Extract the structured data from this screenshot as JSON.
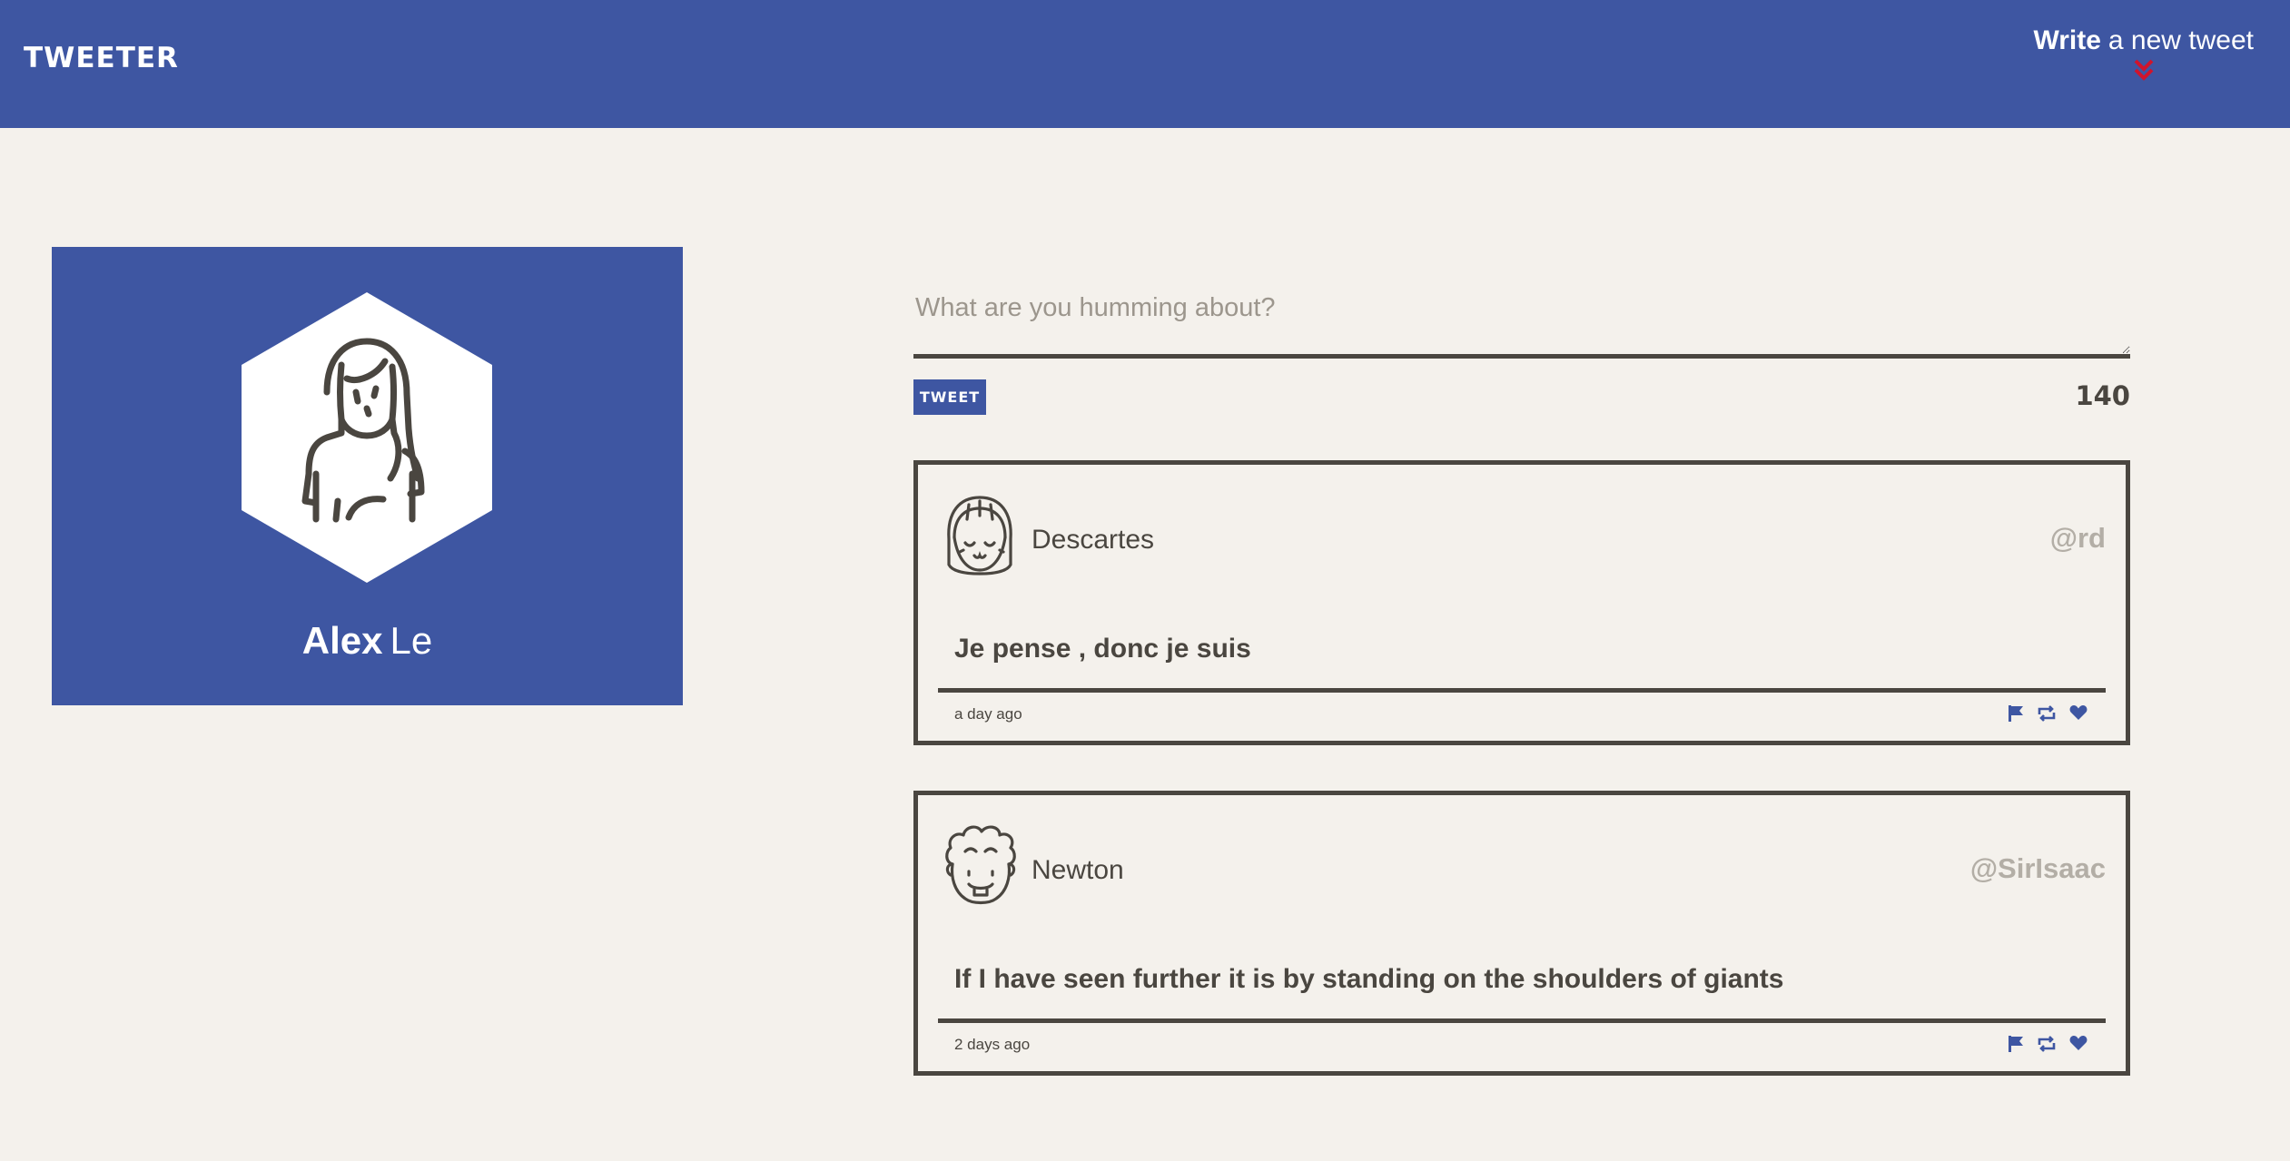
{
  "navbar": {
    "brand": "TWEETER",
    "compose_strong": "Write",
    "compose_rest": "a new tweet",
    "background": "#3e56a2",
    "chevron_color": "#d0142c"
  },
  "profile": {
    "first_name": "Alex",
    "last_name": "Le",
    "avatar_icon": "girl-avatar-icon"
  },
  "composer": {
    "placeholder": "What are you humming about?",
    "button_label": "TWEET",
    "counter": "140"
  },
  "tweets": [
    {
      "name": "Descartes",
      "handle": "@rd",
      "content": "Je pense , donc je suis",
      "time": "a day ago",
      "avatar_icon": "smiling-face-avatar-icon",
      "actions": [
        "flag-icon",
        "retweet-icon",
        "heart-icon"
      ]
    },
    {
      "name": "Newton",
      "handle": "@SirIsaac",
      "content": "If I have seen further it is by standing on the shoulders of giants",
      "time": "2 days ago",
      "avatar_icon": "curly-hair-face-avatar-icon",
      "actions": [
        "flag-icon",
        "retweet-icon",
        "heart-icon"
      ]
    }
  ]
}
